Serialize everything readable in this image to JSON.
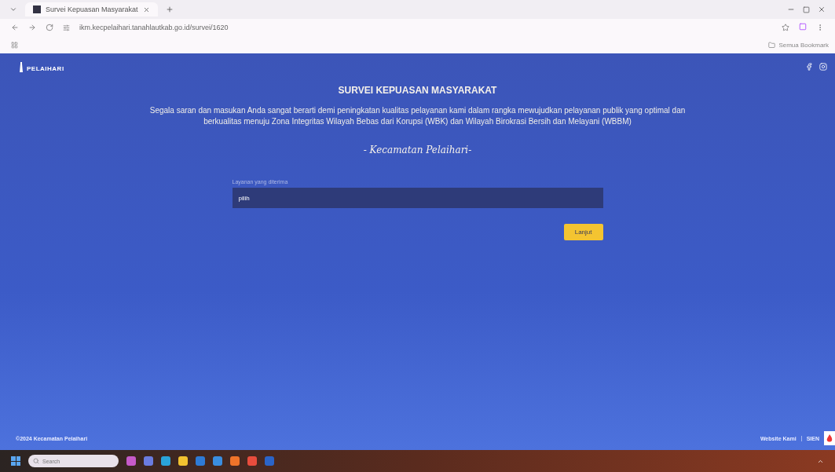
{
  "browser": {
    "tab_title": "Survei Kepuasan Masyarakat",
    "url": "ikm.kecpelaihari.tanahlautkab.go.id/survei/1620",
    "bookmarks_label": "Semua Bookmark"
  },
  "header": {
    "logo_text": "PELAIHARI"
  },
  "survey": {
    "title": "SURVEI KEPUASAN MASYARAKAT",
    "intro": "Segala saran dan masukan Anda sangat berarti demi peningkatan kualitas pelayanan kami dalam rangka mewujudkan pelayanan publik yang optimal dan berkualitas menuju Zona Integritas Wilayah Bebas dari Korupsi (WBK) dan Wilayah Birokrasi Bersih dan Melayani (WBBM)",
    "signature": "- Kecamatan Pelaihari-",
    "field_label": "Layanan yang diterima",
    "field_value": "pilih",
    "button": "Lanjut"
  },
  "footer": {
    "copyright": "©2024 Kecamatan Pelaihari",
    "links": [
      "Website Kami",
      "SIEN"
    ]
  },
  "taskbar": {
    "search_placeholder": "Search"
  }
}
